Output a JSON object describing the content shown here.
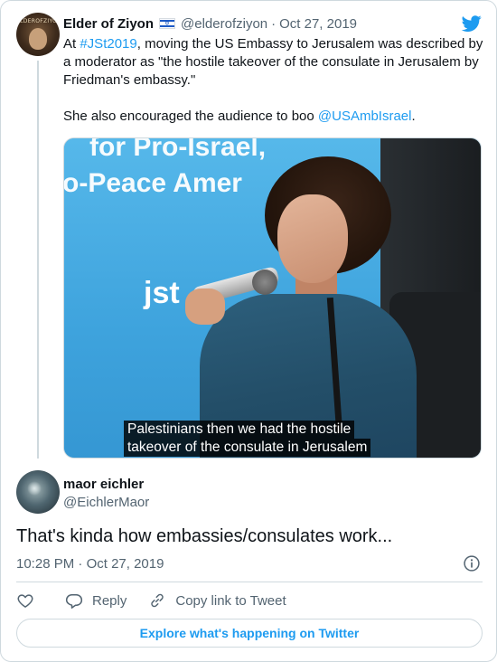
{
  "parent_tweet": {
    "author_name": "Elder of Ziyon",
    "avatar_label": "ELDEROFZIYON",
    "handle": "@elderofziyon",
    "separator": "·",
    "date": "Oct 27, 2019",
    "text_line1_prefix": "At ",
    "hashtag": "#JSt2019",
    "text_line1_rest": ", moving the US Embassy to Jerusalem was described by a moderator as \"the hostile takeover of the consulate in Jerusalem by Friedman's embassy.\"",
    "text_line2_prefix": "She also encouraged the audience to boo ",
    "mention": "@USAmbIsrael",
    "text_line2_suffix": ".",
    "media": {
      "banner_line1": "for Pro-Israel,",
      "banner_line2": "o-Peace Amer",
      "banner_logo": "jst",
      "caption_line1": "Palestinians then we had the hostile",
      "caption_line2": "takeover of the consulate in Jerusalem"
    }
  },
  "reply_tweet": {
    "author_name": "maor eichler",
    "handle": "@EichlerMaor",
    "text": "That's kinda how embassies/consulates work...",
    "time": "10:28 PM",
    "separator": "·",
    "date": "Oct 27, 2019"
  },
  "actions": {
    "reply_label": "Reply",
    "copy_link_label": "Copy link to Tweet"
  },
  "explore_label": "Explore what's happening on Twitter",
  "colors": {
    "accent": "#1d9bf0",
    "text": "#0f1419",
    "secondary": "#536471",
    "border": "#cfd9de"
  },
  "icons": [
    "twitter-bird-icon",
    "israel-flag-icon",
    "info-icon",
    "heart-icon",
    "reply-icon",
    "link-icon"
  ]
}
